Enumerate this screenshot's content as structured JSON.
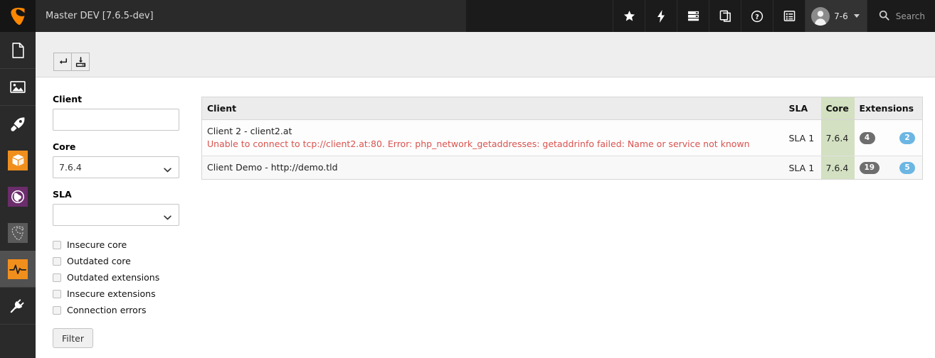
{
  "topbar": {
    "logo_icon": "typo3-logo-icon",
    "title": "Master DEV [7.6.5-dev]",
    "icons": [
      {
        "name": "bookmarks-star-icon",
        "glyph": "star"
      },
      {
        "name": "flash-lightning-icon",
        "glyph": "bolt"
      },
      {
        "name": "system-information-icon",
        "glyph": "server"
      },
      {
        "name": "clipboard-copy-icon",
        "glyph": "copy"
      },
      {
        "name": "help-question-icon",
        "glyph": "question"
      },
      {
        "name": "list-menu-icon",
        "glyph": "list"
      }
    ],
    "user": {
      "label": "7-6",
      "avatar_icon": "user-avatar-icon",
      "caret_icon": "chevron-down-icon"
    },
    "search": {
      "placeholder": "Search",
      "label": "Search",
      "icon": "search-icon"
    }
  },
  "sidebar": {
    "items": [
      {
        "name": "sidebar-item-page",
        "icon": "page-document-icon",
        "style": "plain",
        "selected": false
      },
      {
        "name": "sidebar-item-filelist",
        "icon": "image-picture-icon",
        "style": "plain",
        "selected": false
      },
      {
        "name": "sidebar-item-rocket",
        "icon": "rocket-icon",
        "style": "plain",
        "selected": false
      },
      {
        "name": "sidebar-item-package",
        "icon": "package-box-icon",
        "style": "orange",
        "selected": false
      },
      {
        "name": "sidebar-item-globe",
        "icon": "globe-world-icon",
        "style": "purple",
        "selected": false
      },
      {
        "name": "sidebar-item-typo3",
        "icon": "typo3-outline-icon",
        "style": "gray",
        "selected": false
      },
      {
        "name": "sidebar-item-monitoring",
        "icon": "pulse-activity-icon",
        "style": "orange",
        "selected": true
      },
      {
        "name": "sidebar-item-extensions",
        "icon": "plug-power-icon",
        "style": "plain",
        "selected": false
      }
    ]
  },
  "docheader": {
    "buttons": [
      {
        "name": "go-back-button",
        "icon": "return-arrow-icon",
        "title": "Back"
      },
      {
        "name": "export-button",
        "icon": "save-to-disk-icon",
        "title": "Export"
      }
    ]
  },
  "filters": {
    "client": {
      "label": "Client",
      "value": "",
      "placeholder": ""
    },
    "core": {
      "label": "Core",
      "value": "7.6.4",
      "options": [
        "7.6.4"
      ]
    },
    "sla": {
      "label": "SLA",
      "value": "",
      "options": [
        ""
      ]
    },
    "checkboxes": [
      {
        "label": "Insecure core",
        "checked": false,
        "name": "checkbox-insecure-core"
      },
      {
        "label": "Outdated core",
        "checked": false,
        "name": "checkbox-outdated-core"
      },
      {
        "label": "Outdated extensions",
        "checked": false,
        "name": "checkbox-outdated-extensions"
      },
      {
        "label": "Insecure extensions",
        "checked": false,
        "name": "checkbox-insecure-extensions"
      },
      {
        "label": "Connection errors",
        "checked": false,
        "name": "checkbox-connection-errors"
      }
    ],
    "filter_button": "Filter"
  },
  "table": {
    "columns": [
      "Client",
      "SLA",
      "Core",
      "Extensions"
    ],
    "rows": [
      {
        "client": "Client 2 - client2.at",
        "error": "Unable to connect to tcp://client2.at:80. Error: php_network_getaddresses: getaddrinfo failed: Name or service not known",
        "sla": "SLA 1",
        "core": "7.6.4",
        "ext_gray": "4",
        "ext_blue": "2"
      },
      {
        "client": "Client Demo - http://demo.tld",
        "error": "",
        "sla": "SLA 1",
        "core": "7.6.4",
        "ext_gray": "19",
        "ext_blue": "5"
      }
    ]
  },
  "colors": {
    "topbar_bg": "#1b1b1b",
    "sidebar_bg": "#2a2a2a",
    "accent_orange": "#f18f1d",
    "accent_purple": "#6b2d6b",
    "core_cell_green": "#d3e0c1",
    "error_red": "#d9534f",
    "badge_gray": "#6e6e6e",
    "badge_blue": "#6cb6e3"
  }
}
